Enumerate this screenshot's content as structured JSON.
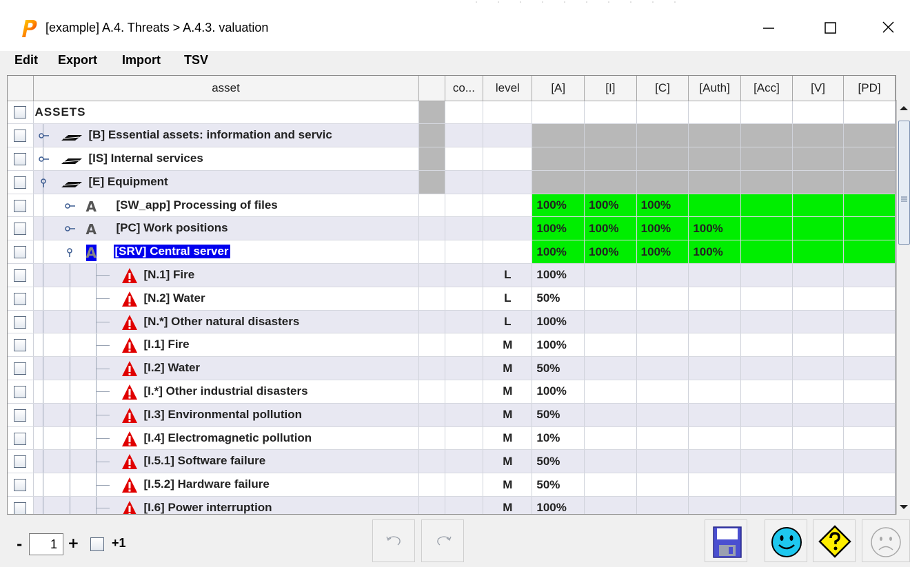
{
  "window": {
    "title": "[example] A.4. Threats > A.4.3. valuation",
    "controls": [
      "minimize",
      "maximize",
      "close"
    ]
  },
  "menu": [
    "Edit",
    "Export",
    "Import",
    "TSV"
  ],
  "columns": [
    "asset",
    "",
    "co...",
    "level",
    "[A]",
    "[I]",
    "[C]",
    "[Auth]",
    "[Acc]",
    "[V]",
    "[PD]"
  ],
  "rows": [
    {
      "label": "ASSETS",
      "kind": "root",
      "depth": 0,
      "level": "",
      "values": [],
      "shade": "gray"
    },
    {
      "label": "[B] Essential assets: information and servic",
      "kind": "group",
      "depth": 1,
      "expanded": false,
      "level": "",
      "values": [],
      "shade": "gray"
    },
    {
      "label": "[IS] Internal services",
      "kind": "group",
      "depth": 1,
      "expanded": false,
      "level": "",
      "values": [],
      "shade": "gray"
    },
    {
      "label": "[E] Equipment",
      "kind": "group",
      "depth": 1,
      "expanded": true,
      "level": "",
      "values": [],
      "shade": "gray"
    },
    {
      "label": "[SW_app] Processing of files",
      "kind": "asset",
      "depth": 2,
      "expanded": false,
      "level": "",
      "values": [
        "100%",
        "100%",
        "100%",
        "",
        "",
        "",
        ""
      ],
      "shade": "green"
    },
    {
      "label": "[PC] Work positions",
      "kind": "asset",
      "depth": 2,
      "expanded": false,
      "level": "",
      "values": [
        "100%",
        "100%",
        "100%",
        "100%",
        "",
        "",
        ""
      ],
      "shade": "green"
    },
    {
      "label": "[SRV] Central server",
      "kind": "asset",
      "depth": 2,
      "expanded": true,
      "selected": true,
      "level": "",
      "values": [
        "100%",
        "100%",
        "100%",
        "100%",
        "",
        "",
        ""
      ],
      "shade": "green"
    },
    {
      "label": "[N.1] Fire",
      "kind": "threat",
      "depth": 3,
      "level": "L",
      "values": [
        "100%",
        "",
        "",
        "",
        "",
        "",
        ""
      ]
    },
    {
      "label": "[N.2] Water",
      "kind": "threat",
      "depth": 3,
      "level": "L",
      "values": [
        "50%",
        "",
        "",
        "",
        "",
        "",
        ""
      ]
    },
    {
      "label": "[N.*] Other natural disasters",
      "kind": "threat",
      "depth": 3,
      "level": "L",
      "values": [
        "100%",
        "",
        "",
        "",
        "",
        "",
        ""
      ]
    },
    {
      "label": "[I.1] Fire",
      "kind": "threat",
      "depth": 3,
      "level": "M",
      "values": [
        "100%",
        "",
        "",
        "",
        "",
        "",
        ""
      ]
    },
    {
      "label": "[I.2] Water",
      "kind": "threat",
      "depth": 3,
      "level": "M",
      "values": [
        "50%",
        "",
        "",
        "",
        "",
        "",
        ""
      ]
    },
    {
      "label": "[I.*] Other industrial disasters",
      "kind": "threat",
      "depth": 3,
      "level": "M",
      "values": [
        "100%",
        "",
        "",
        "",
        "",
        "",
        ""
      ]
    },
    {
      "label": "[I.3] Environmental pollution",
      "kind": "threat",
      "depth": 3,
      "level": "M",
      "values": [
        "50%",
        "",
        "",
        "",
        "",
        "",
        ""
      ]
    },
    {
      "label": "[I.4] Electromagnetic pollution",
      "kind": "threat",
      "depth": 3,
      "level": "M",
      "values": [
        "10%",
        "",
        "",
        "",
        "",
        "",
        ""
      ]
    },
    {
      "label": "[I.5.1] Software failure",
      "kind": "threat",
      "depth": 3,
      "level": "M",
      "values": [
        "50%",
        "",
        "",
        "",
        "",
        "",
        ""
      ]
    },
    {
      "label": "[I.5.2] Hardware failure",
      "kind": "threat",
      "depth": 3,
      "level": "M",
      "values": [
        "50%",
        "",
        "",
        "",
        "",
        "",
        ""
      ]
    },
    {
      "label": "[I.6] Power interruption",
      "kind": "threat",
      "depth": 3,
      "level": "M",
      "values": [
        "100%",
        "",
        "",
        "",
        "",
        "",
        ""
      ]
    }
  ],
  "statusbar": {
    "zoom_minus": "-",
    "zoom_value": "1",
    "zoom_plus": "+",
    "plus_one_label": "+1",
    "buttons": [
      "undo-icon",
      "redo-icon",
      "save-icon",
      "happy-face-icon",
      "help-icon",
      "sad-face-icon"
    ]
  },
  "colors": {
    "accent_selection": "#0000ee",
    "valuation_green": "#00ee00",
    "disabled_gray": "#b8b8b8",
    "row_stripe": "#e8e8f2",
    "threat_red": "#e00000"
  }
}
